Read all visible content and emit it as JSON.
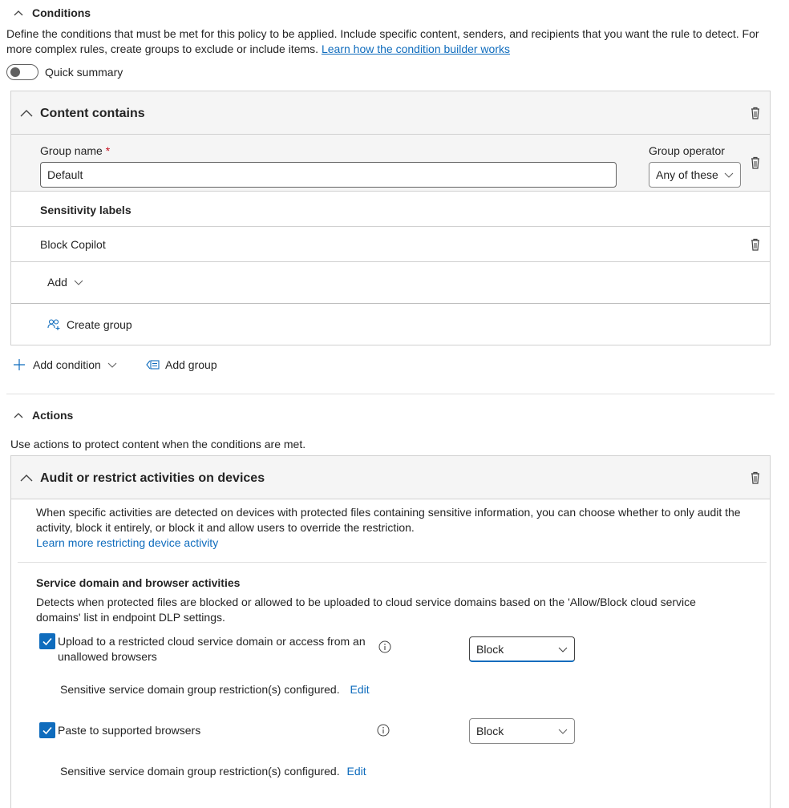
{
  "conditions": {
    "title": "Conditions",
    "description": "Define the conditions that must be met for this policy to be applied. Include specific content, senders, and recipients that you want the rule to detect. For more complex rules, create groups to exclude or include items.",
    "learn_link": "Learn how the condition builder works",
    "quick_summary_label": "Quick summary",
    "quick_summary_on": false
  },
  "content_card": {
    "title": "Content contains",
    "group_name_label": "Group name",
    "required_mark": "*",
    "group_name_value": "Default",
    "group_operator_label": "Group operator",
    "group_operator_value": "Any of these",
    "sensitivity_header": "Sensitivity labels",
    "label_item": "Block Copilot",
    "add_label": "Add",
    "create_group": "Create group"
  },
  "condition_toolbar": {
    "add_condition": "Add condition",
    "add_group": "Add group"
  },
  "actions": {
    "title": "Actions",
    "description": "Use actions to protect content when the conditions are met."
  },
  "device_card": {
    "title": "Audit or restrict activities on devices",
    "description": "When specific activities are detected on devices with protected files containing sensitive information, you can choose whether to only audit the activity, block it entirely, or block it and allow users to override the restriction.",
    "learn_link": "Learn more restricting device activity",
    "service_title": "Service domain and browser activities",
    "service_desc": "Detects when protected files are blocked or allowed to be uploaded to cloud service domains based on the 'Allow/Block cloud service domains' list in endpoint DLP settings.",
    "items": [
      {
        "label": "Upload to a restricted cloud service domain or access from an unallowed browsers",
        "checked": true,
        "select_value": "Block",
        "note": "Sensitive service domain group restriction(s) configured.",
        "edit": "Edit"
      },
      {
        "label": "Paste to supported browsers",
        "checked": true,
        "select_value": "Block",
        "note": "Sensitive service domain group restriction(s) configured.",
        "edit": "Edit"
      }
    ]
  },
  "colors": {
    "accent": "#0f6cbd",
    "header_bg": "#f5f5f5",
    "border": "#d1d1d1",
    "required": "#c50f1f"
  },
  "icons": {
    "collapse": "chevron-up-icon",
    "delete": "trash-icon",
    "dropdown": "chevron-down-icon",
    "info": "info-icon",
    "add": "plus-icon",
    "group": "people-add-icon",
    "add_group": "add-group-icon",
    "check": "checkmark-icon"
  }
}
